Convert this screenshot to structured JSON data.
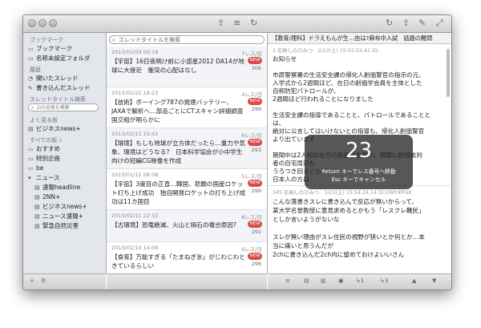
{
  "sidebar": {
    "bookmarks_header": "ブックマーク",
    "bookmarks": [
      "ブックマーク",
      "名称未設定フォルダ"
    ],
    "history_header": "履歴",
    "history": [
      "開いたスレッド",
      "書き込んだスレッド"
    ],
    "title_search_header": "スレッドタイトル検索",
    "search_placeholder": "2ch全体を検索",
    "frequent_header": "よく見る板",
    "frequent": [
      "ビジネスnews+"
    ],
    "all_boards_header": "すべての板",
    "boards": [
      "おすすめ",
      "特別企画",
      "be",
      "ニュース",
      "速報headline",
      "2NN+",
      "ビジネスnews+",
      "ニュース速報+",
      "緊急自然災害"
    ]
  },
  "thread_list": {
    "search_placeholder": "スレッドタイトルを検索",
    "threads": [
      {
        "date": "2013/02/09 00:18",
        "res": "7レス/日",
        "title": "【宇宙】16日夜明け前に小惑星2012 DA14が地球に大接近　衝突の心配はなし",
        "new": "NEW",
        "count": "306"
      },
      {
        "date": "2013/01/22 18:23",
        "res": "4レス/日",
        "title": "【技術】ボーイング787の発煙バッテリー、JAXAで解析へ…部品ごとにCTスキャン詳細調査　国交相が明らかに",
        "new": "NEW",
        "count": "299"
      },
      {
        "date": "2013/02/11 15:43",
        "res": "6レス/日",
        "title": "【環境】もしも地球が立方体だったら…重力や気象、環境はどうなる?　日本科学協会が小中学生向けの短編CG映像を作成",
        "new": "NEW",
        "count": "293"
      },
      {
        "date": "2013/01/12 08:08",
        "res": "5レス/日",
        "title": "【宇宙】3度目の正直…韓国、悲願の国産ロケット打ち上げ成功　独自開発ロケットの打ち上げ成功は11カ国目",
        "new": "NEW",
        "count": "299"
      },
      {
        "date": "2013/02/11 22:33",
        "res": "8レス/日",
        "title": "【古環境】恐竜絶滅、火山と隕石の複合原因?",
        "new": "NEW",
        "count": "291"
      },
      {
        "date": "2013/02/10 14:09",
        "res": "6レス/日",
        "title": "【食育】万能すぎる「たまねぎ氷」がじわじわときているらしい",
        "new": "NEW",
        "count": "296"
      }
    ]
  },
  "detail": {
    "title": "【教育/理科】ドラえもんが生…由は?麻布中入試　話題の難問",
    "post1_head": "2 名無しのひみつ　2/23(土) 15:55:52.41 ID:",
    "post1_lines": [
      "お知らせ",
      "",
      "市原警察署の生活安全課の帰化人創価警官の指示の元、",
      "入学式から2週間ほど、在日の創価学会員を主体とした",
      "自称防犯パトロールが、",
      "2週間ほど行われることになりました",
      "",
      "生活安全課の指導であることと、パトロールであることと",
      "は、",
      "絶対に公言してはいけないとの指導も、帰化人創価警官",
      "より出ています",
      "",
      "期間中は2人組の在日の創価学会員が、頻繁に創価批判",
      "者の自宅周辺を",
      "うろつき回ることに",
      "日本人の方は"
    ],
    "post2_head": "345 名無しのひみつ　3/23(土) 15:54:24.14 ID:DWY4fFoK",
    "post2_lines": [
      "こんな落書きスレに書き込んで反応が無いからって、",
      "某大学名誉教授に意見求めるとかもう「レスクレ難民」",
      "としか言いようがないな",
      "",
      "スレが無い理由がスレ住民の視野が狭いとか何とか…本",
      "当に痛いと思うんだが",
      "2chに書き込んだ2ch内に留めておけよいいさん"
    ]
  },
  "overlay": {
    "number": "23",
    "line1": "Return キーでレス番号へ移動",
    "line2": "Esc キーでキャンセル"
  },
  "bottom_bar": {
    "anchor1": "1",
    "anchor2": "3"
  }
}
